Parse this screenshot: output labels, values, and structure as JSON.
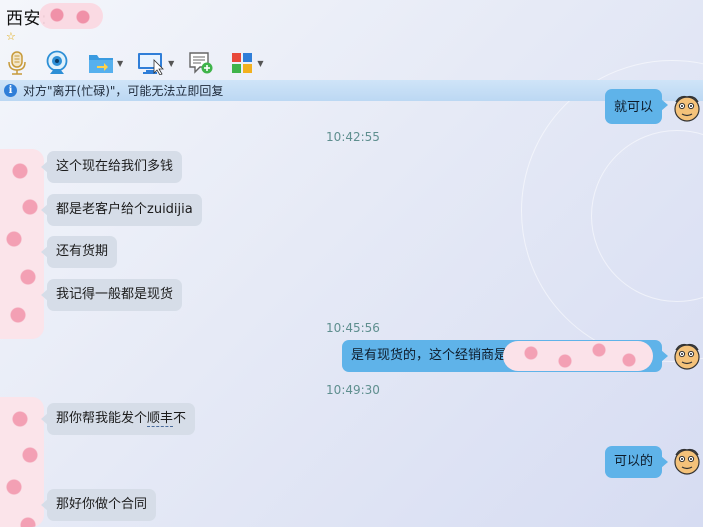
{
  "header": {
    "contact_name": "西安:",
    "star_icon": "star-icon"
  },
  "toolbar": {
    "tools": [
      {
        "name": "microphone-icon",
        "has_dropdown": false
      },
      {
        "name": "webcam-icon",
        "has_dropdown": false
      },
      {
        "name": "folder-transfer-icon",
        "has_dropdown": true
      },
      {
        "name": "screen-share-icon",
        "has_dropdown": true
      },
      {
        "name": "add-note-icon",
        "has_dropdown": false
      },
      {
        "name": "apps-grid-icon",
        "has_dropdown": true
      }
    ]
  },
  "notice": {
    "text": "对方\"离开(忙碌)\"，可能无法立即回复"
  },
  "messages": {
    "partial_top": "就可以",
    "ts1": "10:42:55",
    "m1": "这个现在给我们多钱",
    "m2": "都是老客户给个zuidijia",
    "m3": "还有货期",
    "m4": "我记得一般都是现货",
    "ts2": "10:45:56",
    "m5": "是有现货的，这个经销商是",
    "ts3": "10:49:30",
    "m6_pre": "那你帮我能发个",
    "m6_dashed": "顺丰",
    "m6_post": "不",
    "m7": "可以的",
    "m8": "那好你做个合同"
  },
  "colors": {
    "incoming_bubble": "#d6dde8",
    "outgoing_bubble": "#5fb3e9",
    "timestamp": "#5f8f8f",
    "notice_bg": "#c6def6",
    "redaction": "#fbe2e9"
  }
}
